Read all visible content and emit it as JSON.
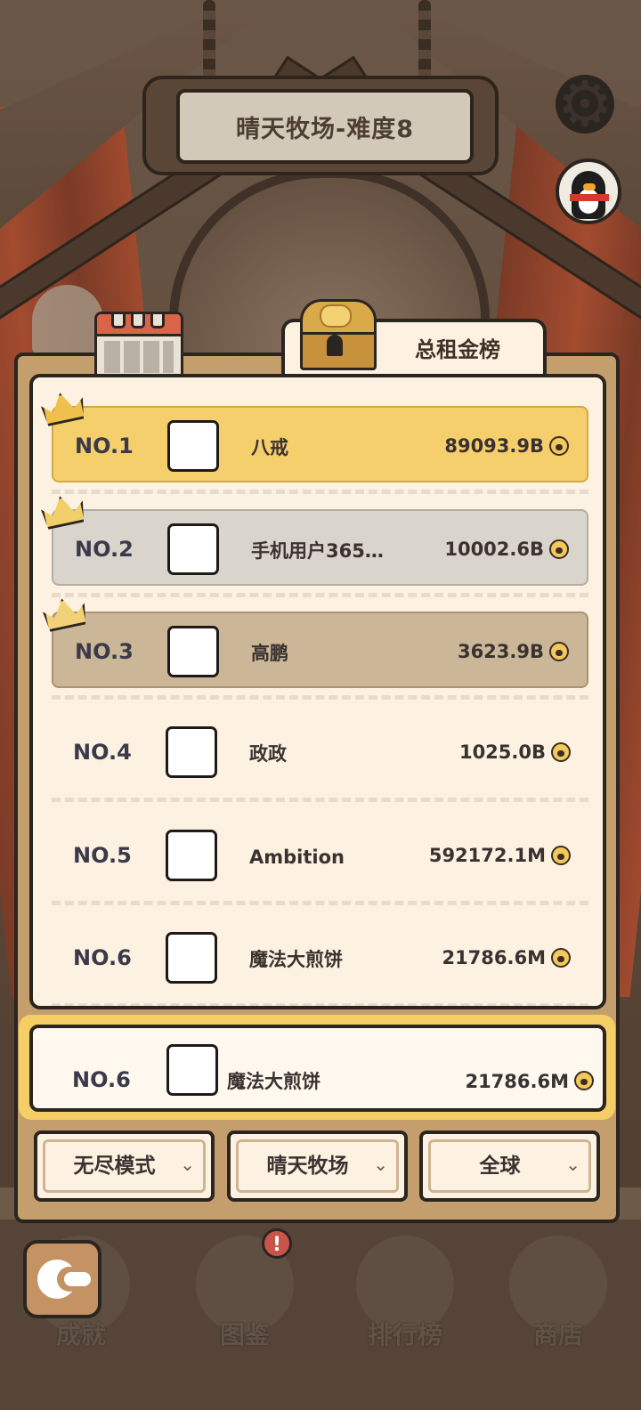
{
  "header": {
    "title": "晴天牧场-难度8"
  },
  "leaderboard": {
    "tab_label": "总租金榜",
    "rows": [
      {
        "rank": "NO.1",
        "name": "八戒",
        "score": "89093.9B"
      },
      {
        "rank": "NO.2",
        "name": "手机用户365…",
        "score": "10002.6B"
      },
      {
        "rank": "NO.3",
        "name": "高鹏",
        "score": "3623.9B"
      },
      {
        "rank": "NO.4",
        "name": "政政",
        "score": "1025.0B"
      },
      {
        "rank": "NO.5",
        "name": "Ambition",
        "score": "592172.1M"
      },
      {
        "rank": "NO.6",
        "name": "魔法大煎饼",
        "score": "21786.6M"
      }
    ],
    "my_rank": {
      "rank": "NO.6",
      "name": "魔法大煎饼",
      "score": "21786.6M"
    }
  },
  "filters": {
    "mode": "无尽模式",
    "map": "晴天牧场",
    "region": "全球"
  },
  "nav": {
    "items": [
      {
        "label": "成就",
        "icon": "achievement-icon"
      },
      {
        "label": "图鉴",
        "icon": "paw-book-icon"
      },
      {
        "label": "排行榜",
        "icon": "scroll-icon"
      },
      {
        "label": "商店",
        "icon": "shop-icon"
      }
    ],
    "badge": "!"
  },
  "colors": {
    "gold_row": "#f6cf6d",
    "silver_row": "#d9d4cc",
    "bronze_row": "#cbb797",
    "panel": "#c59e6d",
    "list_bg": "#fdf2e2"
  }
}
